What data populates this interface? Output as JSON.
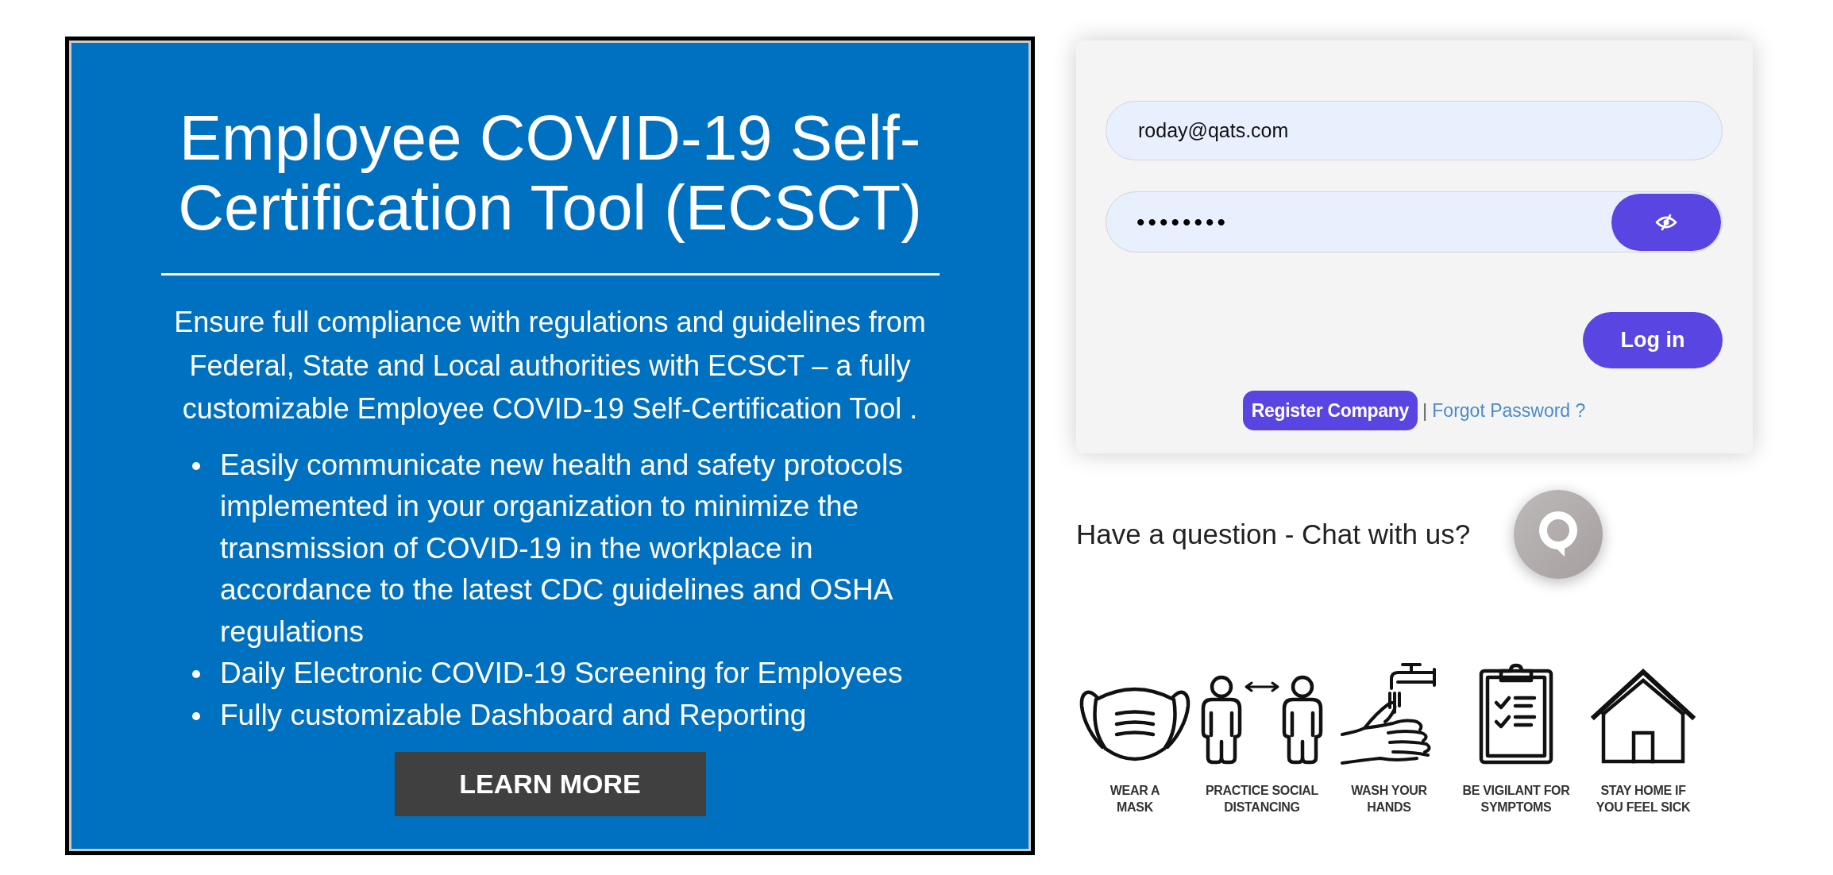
{
  "promo": {
    "title": "Employee COVID-19 Self-Certification Tool (ECSCT)",
    "description": "Ensure full compliance with regulations and guidelines from Federal, State and Local authorities with ECSCT – a fully customizable Employee COVID-19 Self-Certification Tool .",
    "bullets": [
      "Easily communicate new health and safety protocols implemented in your organization to minimize the transmission of COVID-19 in the workplace in accordance to the latest CDC guidelines and OSHA regulations",
      "Daily Electronic COVID-19 Screening for Employees",
      "Fully customizable Dashboard and Reporting"
    ],
    "button": "LEARN MORE"
  },
  "login": {
    "email": {
      "value": "roday@qats.com"
    },
    "password": {
      "value": "••••••••"
    },
    "login_button": "Log in",
    "register_button": "Register Company",
    "separator": "|",
    "forgot_link": "Forgot Password ?"
  },
  "chat": {
    "prompt": "Have a question - Chat with us?"
  },
  "guidelines": [
    {
      "kind": "mask",
      "label": "WEAR A\nMASK"
    },
    {
      "kind": "distancing",
      "label": "PRACTICE SOCIAL\nDISTANCING"
    },
    {
      "kind": "handwashing",
      "label": "WASH YOUR\nHANDS"
    },
    {
      "kind": "checklist",
      "label": "BE VIGILANT FOR\nSYMPTOMS"
    },
    {
      "kind": "home",
      "label": "STAY HOME IF\nYOU FEEL SICK"
    }
  ]
}
